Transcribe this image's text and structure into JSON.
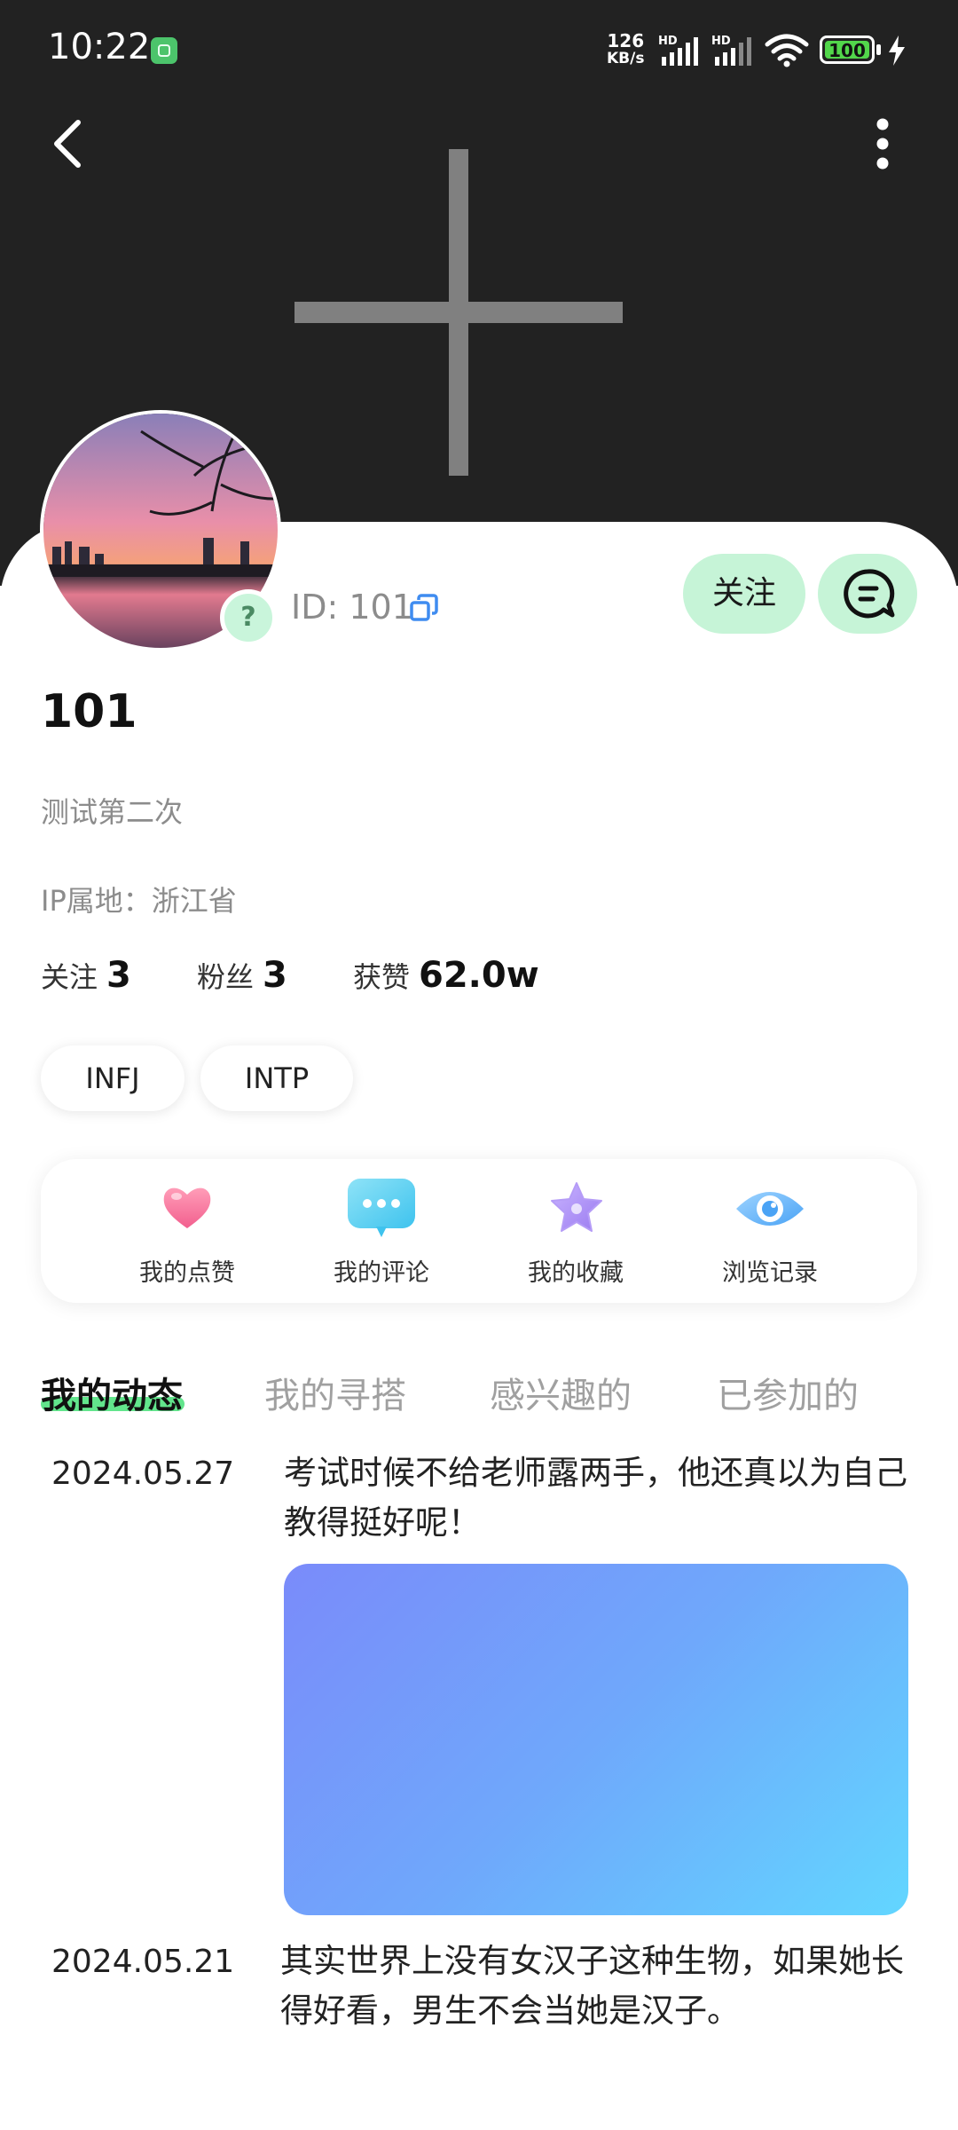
{
  "status_bar": {
    "time": "10:22",
    "net_speed_value": "126",
    "net_speed_unit": "KB/s",
    "signal_label_1": "HD",
    "signal_label_2": "HD",
    "battery": "100",
    "colors": {
      "battery_fill": "#52d64b",
      "app_icon": "#4cc46b"
    }
  },
  "header": {
    "back_icon": "chevron-left-icon",
    "more_icon": "more-vertical-icon",
    "cover_icon": "plus-icon"
  },
  "profile": {
    "id_text": "ID: 101",
    "nickname": "101",
    "bio": "测试第二次",
    "ip_location": "IP属地：浙江省",
    "follow_button": "关注",
    "stats": [
      {
        "label": "关注",
        "value": "3"
      },
      {
        "label": "粉丝",
        "value": "3"
      },
      {
        "label": "获赞",
        "value": "62.0w"
      }
    ],
    "tags": [
      "INFJ",
      "INTP"
    ]
  },
  "actions": [
    {
      "label": "我的点赞",
      "icon": "heart-icon"
    },
    {
      "label": "我的评论",
      "icon": "comment-icon"
    },
    {
      "label": "我的收藏",
      "icon": "star-icon"
    },
    {
      "label": "浏览记录",
      "icon": "eye-icon"
    }
  ],
  "tabs": [
    {
      "label": "我的动态",
      "active": true
    },
    {
      "label": "我的寻搭",
      "active": false
    },
    {
      "label": "感兴趣的",
      "active": false
    },
    {
      "label": "已参加的",
      "active": false
    }
  ],
  "posts": [
    {
      "date": "2024.05.27",
      "text": "考试时候不给老师露两手，他还真以为自己教得挺好呢！"
    },
    {
      "date": "2024.05.21",
      "text": "其实世界上没有女汉子这种生物，如果她长得好看，男生不会当她是汉子。"
    }
  ],
  "colors": {
    "accent": "#62e58c",
    "button_bg": "#c6f4d7",
    "header_bg": "#222222"
  }
}
